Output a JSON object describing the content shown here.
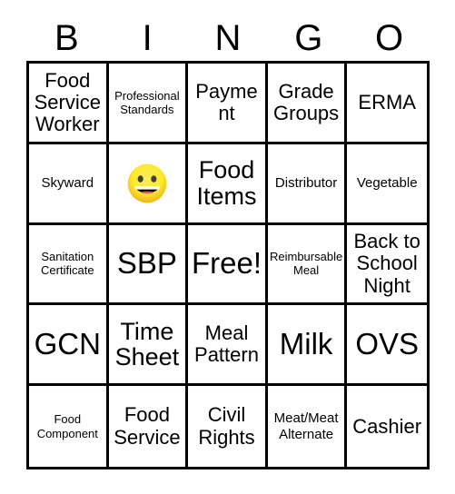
{
  "card": {
    "title_letters": [
      "B",
      "I",
      "N",
      "G",
      "O"
    ],
    "free_space_icon": "grinning-face-emoji",
    "colors": {
      "border": "#000000",
      "cell_background": "#ffffff",
      "text": "#000000",
      "emoji_face_light": "#FCEA2B",
      "emoji_face_dark": "#F1B31C",
      "emoji_features": "#3F3F3F",
      "emoji_mouth": "#000000",
      "emoji_tongue": "#EA5A47"
    },
    "rows": [
      [
        {
          "label": "Food Service Worker",
          "size": "md"
        },
        {
          "label": "Professional Standards",
          "size": "xs"
        },
        {
          "label": "Payment",
          "size": "md"
        },
        {
          "label": "Grade Groups",
          "size": "md"
        },
        {
          "label": "ERMA",
          "size": "md"
        }
      ],
      [
        {
          "label": "Skyward",
          "size": "sm"
        },
        {
          "label": "",
          "size": "md",
          "icon": "grinning-face-emoji"
        },
        {
          "label": "Food Items",
          "size": "lg"
        },
        {
          "label": "Distributor",
          "size": "sm"
        },
        {
          "label": "Vegetable",
          "size": "sm"
        }
      ],
      [
        {
          "label": "Sanitation Certificate",
          "size": "xs"
        },
        {
          "label": "SBP",
          "size": "xl"
        },
        {
          "label": "Free!",
          "size": "xl"
        },
        {
          "label": "Reimbursable Meal",
          "size": "xs"
        },
        {
          "label": "Back to School Night",
          "size": "md"
        }
      ],
      [
        {
          "label": "GCN",
          "size": "xl"
        },
        {
          "label": "Time Sheet",
          "size": "lg"
        },
        {
          "label": "Meal Pattern",
          "size": "md"
        },
        {
          "label": "Milk",
          "size": "xl"
        },
        {
          "label": "OVS",
          "size": "xl"
        }
      ],
      [
        {
          "label": "Food Component",
          "size": "xs"
        },
        {
          "label": "Food Service",
          "size": "md"
        },
        {
          "label": "Civil Rights",
          "size": "md"
        },
        {
          "label": "Meat/Meat Alternate",
          "size": "sm"
        },
        {
          "label": "Cashier",
          "size": "md"
        }
      ]
    ]
  }
}
